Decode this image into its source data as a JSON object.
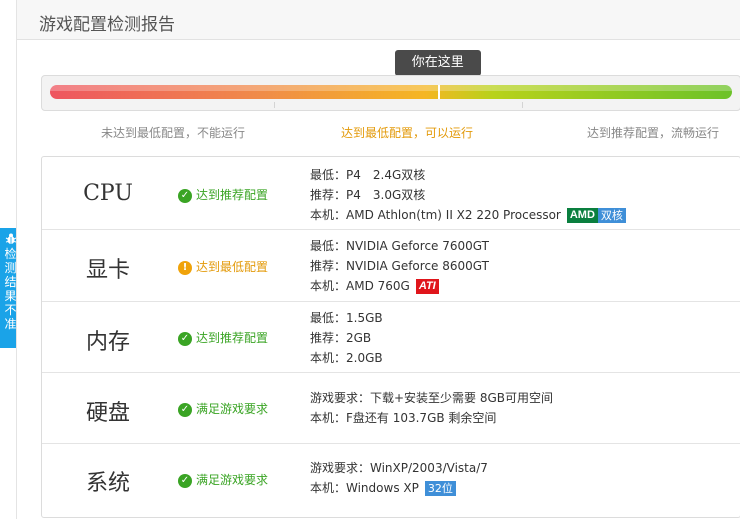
{
  "header": {
    "title": "游戏配置检测报告"
  },
  "progress": {
    "tooltip": "你在这里",
    "level": 0.57,
    "labels": {
      "low": "未达到最低配置，不能运行",
      "min": "达到最低配置，可以运行",
      "rec": "达到推荐配置，流畅运行"
    }
  },
  "side_tab": {
    "label": "检测结果不准",
    "icon": "bug-icon"
  },
  "colors": {
    "ok": "#3aa424",
    "warn": "#e39a0a",
    "accent": "#1aa3e8"
  },
  "rows": {
    "cpu": {
      "name": "CPU",
      "status": "达到推荐配置",
      "lines": [
        "最低：P4　2.4G双核",
        "推荐：P4　3.0G双核",
        "本机：AMD Athlon(tm) II X2 220 Processor"
      ],
      "badges": [
        "AMD",
        "双核"
      ]
    },
    "gpu": {
      "name": "显卡",
      "status": "达到最低配置",
      "lines": [
        "最低：NVIDIA Geforce 7600GT",
        "推荐：NVIDIA Geforce 8600GT",
        "本机：AMD 760G"
      ],
      "badges": [
        "ATI"
      ]
    },
    "mem": {
      "name": "内存",
      "status": "达到推荐配置",
      "lines": [
        "最低：1.5GB",
        "推荐：2GB",
        "本机：2.0GB"
      ]
    },
    "disk": {
      "name": "硬盘",
      "status": "满足游戏要求",
      "lines": [
        "游戏要求：下载+安装至少需要 8GB可用空间",
        "本机：F盘还有 103.7GB 剩余空间"
      ]
    },
    "os": {
      "name": "系统",
      "status": "满足游戏要求",
      "lines": [
        "游戏要求：WinXP/2003/Vista/7",
        "本机：Windows XP"
      ],
      "badges": [
        "32位"
      ]
    }
  }
}
